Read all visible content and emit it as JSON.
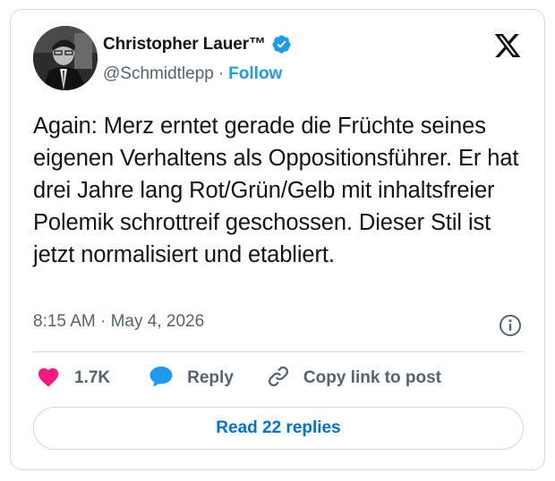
{
  "author": {
    "name": "Christopher Lauer™",
    "handle": "@Schmidtlepp",
    "separator": "·",
    "follow_label": "Follow"
  },
  "tweet": {
    "text": "Again: Merz erntet gerade die Früchte seines eigenen Verhaltens als Oppositionsführer. Er hat drei Jahre lang Rot/Grün/Gelb mit inhaltsfreier Polemik schrottreif geschossen. Dieser Stil ist jetzt normalisiert und etabliert.",
    "timestamp": "8:15 AM · May 4, 2026"
  },
  "actions": {
    "like_count": "1.7K",
    "reply_label": "Reply",
    "copy_link_label": "Copy link to post"
  },
  "read_replies_label": "Read 22 replies",
  "icons": {
    "verified": "verified-badge-icon",
    "logo": "x-logo-icon",
    "info": "info-icon",
    "like": "heart-icon",
    "reply": "speech-bubble-icon",
    "copy": "link-icon"
  },
  "colors": {
    "verified_blue": "#1d9bf0",
    "like_pink": "#f91880",
    "reply_blue": "#1d9bf0",
    "link_blue": "#006fd6",
    "secondary_text": "#536471",
    "border": "#cfd9de"
  }
}
